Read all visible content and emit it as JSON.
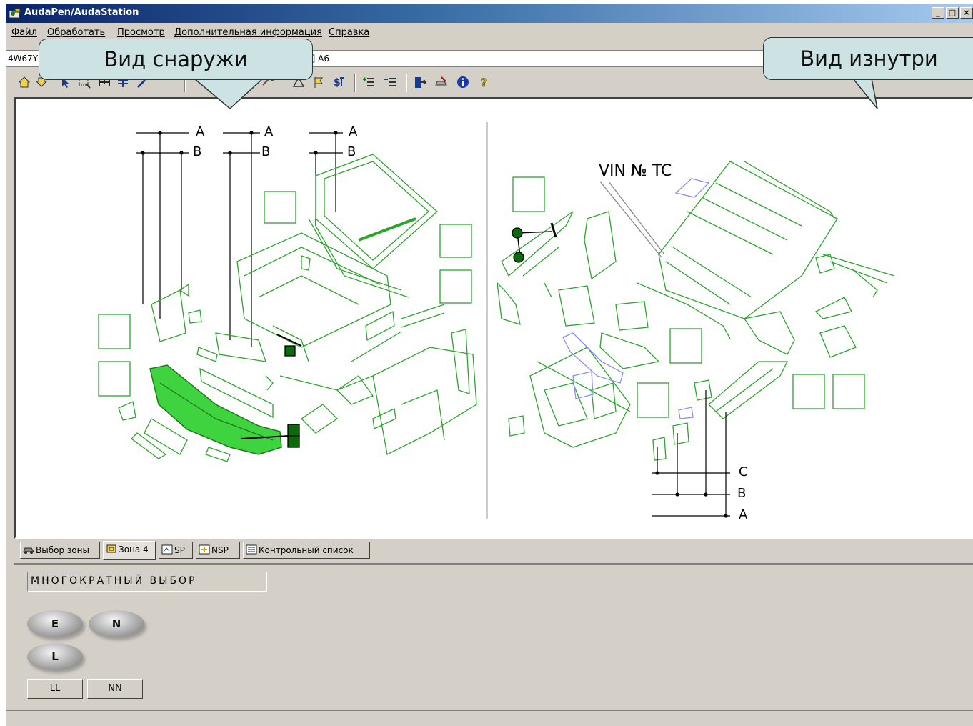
{
  "window": {
    "title": "AudaPen/AudaStation",
    "buttons": {
      "minimize": "_",
      "maximize": "□",
      "close": "×"
    }
  },
  "menu": [
    "Файл",
    "Обработать",
    "Просмотр",
    "Дополнительная информация",
    "Справка"
  ],
  "path_bar": {
    "left_text": "4W67Y",
    "right_text": "1] A6"
  },
  "callouts": {
    "outside": "Вид снаружи",
    "inside": "Вид изнутри"
  },
  "diagram": {
    "left_labels": {
      "a": "A",
      "b": "B"
    },
    "vin_label": "VIN № TC",
    "right_labels": {
      "c": "C",
      "b": "B",
      "a": "A"
    }
  },
  "tabs": [
    "Выбор зоны",
    "Зона 4",
    "SP",
    "NSP",
    "Контрольный список"
  ],
  "lower": {
    "multi_select": "МНОГОКРАТНЫЙ ВЫБОР",
    "oval_buttons": [
      "E",
      "N",
      "L"
    ],
    "small_buttons": [
      "LL",
      "NN"
    ]
  },
  "colors": {
    "titlebar_start": "#0a246a",
    "titlebar_end": "#a6caf0",
    "part_outline": "#2ca52c",
    "part_selected": "#3fd33f",
    "part_marker": "#0b6b0b",
    "part_highlight": "#8c8cf0",
    "callout_bg": "#cde3e3"
  }
}
